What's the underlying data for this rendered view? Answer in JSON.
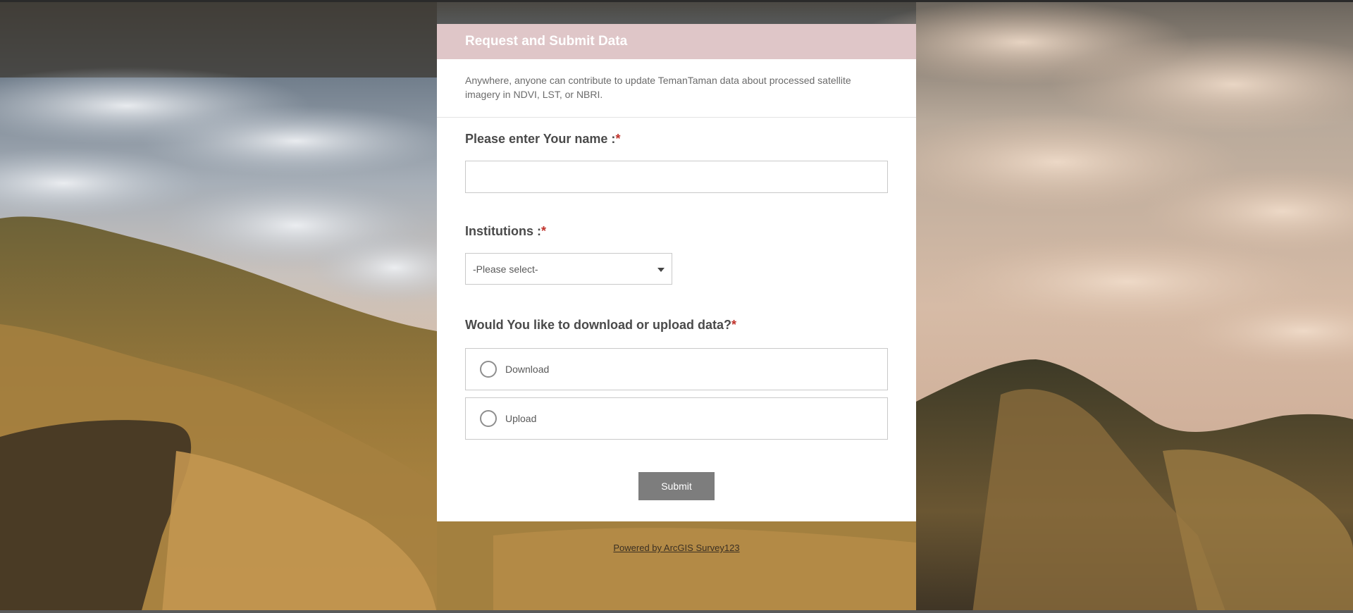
{
  "form": {
    "title": "Request and Submit Data",
    "description": "Anywhere, anyone can contribute to update TemanTaman data about processed satellite imagery in NDVI, LST, or NBRI.",
    "questions": {
      "name": {
        "label": "Please enter Your name :",
        "required_mark": "*",
        "value": ""
      },
      "institutions": {
        "label": "Institutions :",
        "required_mark": "*",
        "selected": "-Please select-"
      },
      "download_upload": {
        "label": "Would You like to download or upload data?",
        "required_mark": "*",
        "options": [
          "Download",
          "Upload"
        ]
      }
    },
    "submit_label": "Submit"
  },
  "footer": {
    "powered_by": "Powered by ArcGIS Survey123"
  },
  "colors": {
    "header_bg": "#dfc6c8",
    "required": "#c0322b",
    "submit_bg": "#7d7d7d"
  }
}
